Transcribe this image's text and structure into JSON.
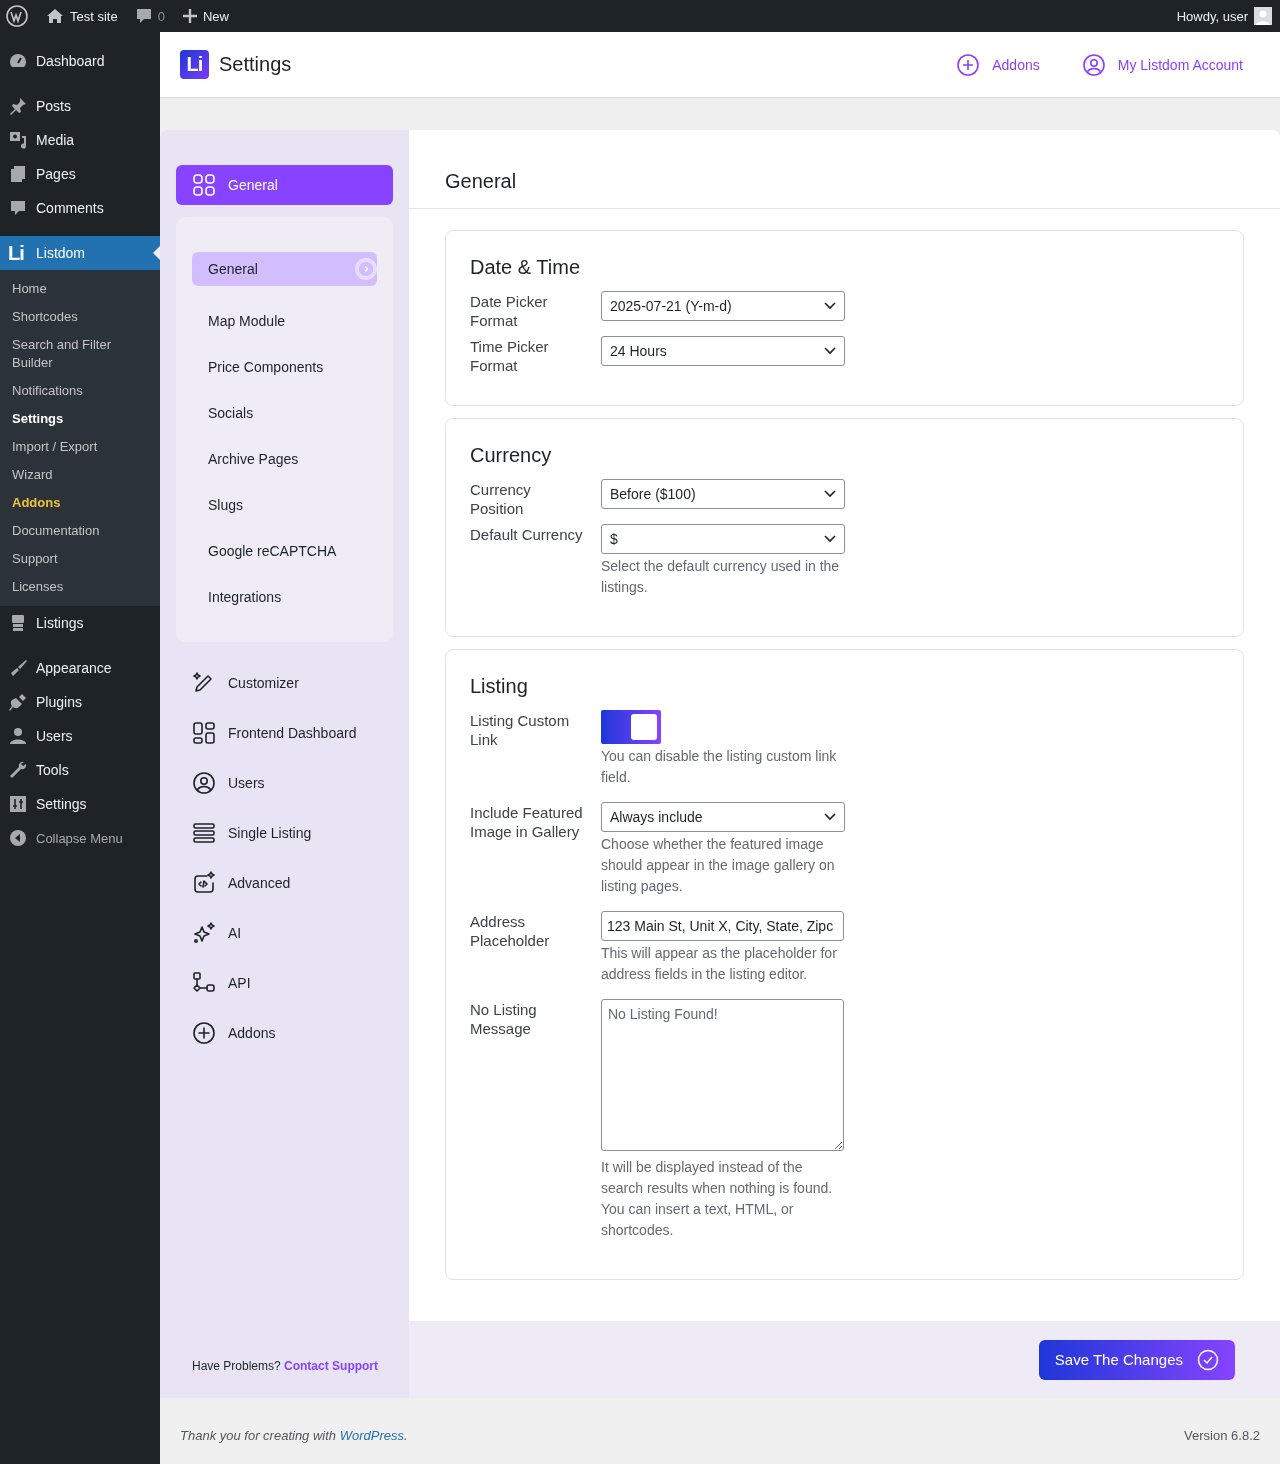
{
  "admin_bar": {
    "site": "Test site",
    "comments": "0",
    "new": "New",
    "greeting": "Howdy, user"
  },
  "sidebar": {
    "items": [
      {
        "kind": "menu",
        "label": "Dashboard",
        "selected": false
      },
      {
        "kind": "menu",
        "label": "Posts",
        "selected": false
      },
      {
        "kind": "menu",
        "label": "Media",
        "selected": false
      },
      {
        "kind": "menu",
        "label": "Pages",
        "selected": false
      },
      {
        "kind": "menu",
        "label": "Comments",
        "selected": false
      },
      {
        "kind": "plugin",
        "logo": "Li",
        "label": "Listdom",
        "selected": true,
        "submenu": [
          {
            "label": "Home",
            "selected": false,
            "highlight": false
          },
          {
            "label": "Shortcodes",
            "selected": false,
            "highlight": false
          },
          {
            "label": "Search and Filter Builder",
            "selected": false,
            "highlight": false
          },
          {
            "label": "Notifications",
            "selected": false,
            "highlight": false
          },
          {
            "label": "Settings",
            "selected": true,
            "highlight": false
          },
          {
            "label": "Import / Export",
            "selected": false,
            "highlight": false
          },
          {
            "label": "Wizard",
            "selected": false,
            "highlight": false
          },
          {
            "label": "Addons",
            "selected": false,
            "highlight": true
          },
          {
            "label": "Documentation",
            "selected": false,
            "highlight": false
          },
          {
            "label": "Support",
            "selected": false,
            "highlight": false
          },
          {
            "label": "Licenses",
            "selected": false,
            "highlight": false
          }
        ]
      },
      {
        "kind": "menu",
        "label": "Listings",
        "selected": false
      },
      {
        "kind": "menu",
        "label": "Appearance",
        "selected": false
      },
      {
        "kind": "menu",
        "label": "Plugins",
        "selected": false
      },
      {
        "kind": "menu",
        "label": "Users",
        "selected": false
      },
      {
        "kind": "menu",
        "label": "Tools",
        "selected": false
      },
      {
        "kind": "menu",
        "label": "Settings",
        "selected": false
      },
      {
        "kind": "collapse",
        "label": "Collapse Menu",
        "selected": false
      }
    ]
  },
  "header": {
    "logo": "Li",
    "title": "Settings",
    "links": [
      {
        "label": "Addons"
      },
      {
        "label": "My Listdom Account"
      }
    ]
  },
  "settings_nav": {
    "items": [
      {
        "label": "General",
        "selected": true,
        "children": [
          {
            "label": "General",
            "selected": true
          },
          {
            "label": "Map Module",
            "selected": false
          },
          {
            "label": "Price Components",
            "selected": false
          },
          {
            "label": "Socials",
            "selected": false
          },
          {
            "label": "Archive Pages",
            "selected": false
          },
          {
            "label": "Slugs",
            "selected": false
          },
          {
            "label": "Google reCAPTCHA",
            "selected": false
          },
          {
            "label": "Integrations",
            "selected": false
          }
        ]
      },
      {
        "label": "Customizer",
        "selected": false
      },
      {
        "label": "Frontend Dashboard",
        "selected": false
      },
      {
        "label": "Users",
        "selected": false
      },
      {
        "label": "Single Listing",
        "selected": false
      },
      {
        "label": "Advanced",
        "selected": false
      },
      {
        "label": "AI",
        "selected": false
      },
      {
        "label": "API",
        "selected": false
      },
      {
        "label": "Addons",
        "selected": false
      }
    ],
    "help": {
      "text": "Have Problems?",
      "link": "Contact Support"
    }
  },
  "content": {
    "title": "General",
    "sections": [
      {
        "title": "Date & Time",
        "fields": [
          {
            "kind": "select",
            "label": "Date Picker Format",
            "value": "2025-07-21 (Y-m-d)"
          },
          {
            "kind": "select",
            "label": "Time Picker Format",
            "value": "24 Hours"
          }
        ]
      },
      {
        "title": "Currency",
        "fields": [
          {
            "kind": "select",
            "label": "Currency Position",
            "value": "Before ($100)"
          },
          {
            "kind": "select",
            "label": "Default Currency",
            "value": "$",
            "help": "Select the default currency used in the listings."
          }
        ]
      },
      {
        "title": "Listing",
        "fields": [
          {
            "kind": "toggle",
            "label": "Listing Custom Link",
            "on": true,
            "help": "You can disable the listing custom link field."
          },
          {
            "kind": "select",
            "label": "Include Featured Image in Gallery",
            "value": "Always include",
            "help": "Choose whether the featured image should appear in the image gallery on listing pages."
          },
          {
            "kind": "input",
            "label": "Address Placeholder",
            "value": "123 Main St, Unit X, City, State, Zipc",
            "help": "This will appear as the placeholder for address fields in the listing editor."
          },
          {
            "kind": "textarea",
            "label": "No Listing Message",
            "placeholder": "No Listing Found!",
            "help": "It will be displayed instead of the search results when nothing is found. You can insert a text, HTML, or shortcodes."
          }
        ]
      }
    ]
  },
  "save_button": "Save The Changes",
  "footer": {
    "text": "Thank you for creating with",
    "link": "WordPress",
    "end": ".",
    "version": "Version 6.8.2"
  }
}
